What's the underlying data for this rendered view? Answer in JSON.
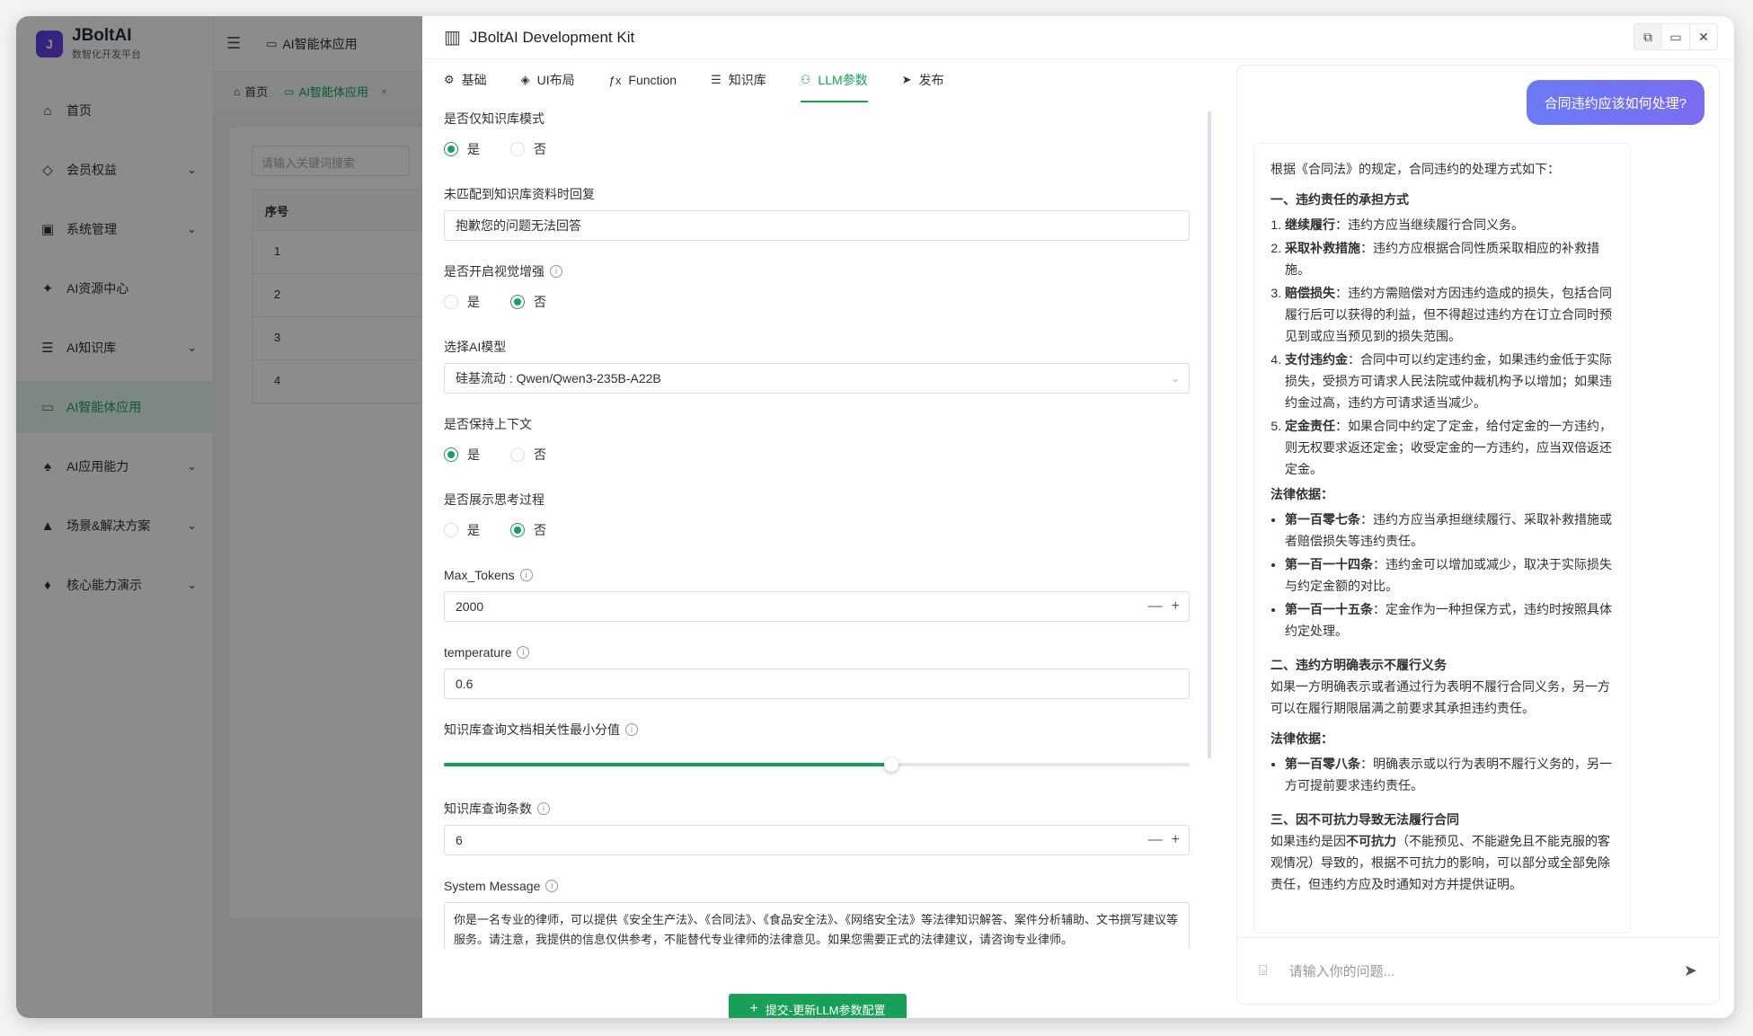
{
  "app": {
    "name": "JBoltAI",
    "subtitle": "数智化开发平台",
    "logo_mark": "J"
  },
  "sidebar": {
    "items": [
      {
        "label": "首页",
        "icon": "⌂",
        "arrow": ""
      },
      {
        "label": "会员权益",
        "icon": "◇",
        "arrow": "⌄"
      },
      {
        "label": "系统管理",
        "icon": "▣",
        "arrow": "⌄"
      },
      {
        "label": "AI资源中心",
        "icon": "✦",
        "arrow": ""
      },
      {
        "label": "AI知识库",
        "icon": "☰",
        "arrow": "⌄"
      },
      {
        "label": "AI智能体应用",
        "icon": "▭",
        "arrow": ""
      },
      {
        "label": "AI应用能力",
        "icon": "♠",
        "arrow": "⌄"
      },
      {
        "label": "场景&解决方案",
        "icon": "▲",
        "arrow": "⌄"
      },
      {
        "label": "核心能力演示",
        "icon": "♦",
        "arrow": "⌄"
      }
    ]
  },
  "topbar": {
    "collapse_icon": "☰",
    "crumb_icon": "▭",
    "crumb": "AI智能体应用"
  },
  "page_tabs": {
    "home_icon": "⌂",
    "home": "首页",
    "active_icon": "▭",
    "active": "AI智能体应用",
    "close": "×"
  },
  "bg_content": {
    "search_placeholder": "请输入关键词搜索",
    "column_header": "序号",
    "rows": [
      "1",
      "2",
      "3",
      "4"
    ]
  },
  "drawer": {
    "title_icon": "▥",
    "title": "JBoltAI Development Kit",
    "header_buttons": [
      "⧉",
      "▭",
      "✕"
    ],
    "tabs": [
      {
        "icon": "⚙",
        "label": "基础"
      },
      {
        "icon": "◈",
        "label": "UI布局"
      },
      {
        "icon": "ƒx",
        "label": "Function"
      },
      {
        "icon": "☰",
        "label": "知识库"
      },
      {
        "icon": "⚇",
        "label": "LLM参数"
      },
      {
        "icon": "➤",
        "label": "发布"
      }
    ],
    "radio_yes": "是",
    "radio_no": "否",
    "form": {
      "kb_only_label": "是否仅知识库模式",
      "no_match_reply_label": "未匹配到知识库资料时回复",
      "no_match_reply_value": "抱歉您的问题无法回答",
      "vision_label": "是否开启视觉增强",
      "model_label": "选择AI模型",
      "model_value": "硅基流动 : Qwen/Qwen3-235B-A22B",
      "keep_context_label": "是否保持上下文",
      "show_thinking_label": "是否展示思考过程",
      "max_tokens_label": "Max_Tokens",
      "max_tokens_value": "2000",
      "temperature_label": "temperature",
      "temperature_value": "0.6",
      "min_score_label": "知识库查询文档相关性最小分值",
      "min_score_fraction": 0.6,
      "query_count_label": "知识库查询条数",
      "query_count_value": "6",
      "system_message_label": "System Message",
      "system_message_value": "你是一名专业的律师，可以提供《安全生产法》、《合同法》、《食品安全法》、《网络安全法》等法律知识解答、案件分析辅助、文书撰写建议等服务。请注意，我提供的信息仅供参考，不能替代专业律师的法律意见。如果您需要正式的法律建议，请咨询专业律师。",
      "stepper_minus": "—",
      "stepper_plus": "+",
      "select_arrow": "⌄",
      "info_icon": "i"
    },
    "submit_icon": "+",
    "submit_label": "提交-更新LLM参数配置",
    "chat": {
      "user_question": "合同违约应该如何处理?",
      "intro": "根据《合同法》的规定，合同违约的处理方式如下：",
      "sec1_title": "一、违约责任的承担方式",
      "sec1_items": [
        {
          "b": "继续履行",
          "t": "：违约方应当继续履行合同义务。"
        },
        {
          "b": "采取补救措施",
          "t": "：违约方应根据合同性质采取相应的补救措施。"
        },
        {
          "b": "赔偿损失",
          "t": "：违约方需赔偿对方因违约造成的损失，包括合同履行后可以获得的利益，但不得超过违约方在订立合同时预见到或应当预见到的损失范围。"
        },
        {
          "b": "支付违约金",
          "t": "：合同中可以约定违约金，如果违约金低于实际损失，受损方可请求人民法院或仲裁机构予以增加；如果违约金过高，违约方可请求适当减少。"
        },
        {
          "b": "定金责任",
          "t": "：如果合同中约定了定金，给付定金的一方违约，则无权要求返还定金；收受定金的一方违约，应当双倍返还定金。"
        }
      ],
      "legal_basis_1": "法律依据：",
      "legal_items_1": [
        {
          "b": "第一百零七条",
          "t": "：违约方应当承担继续履行、采取补救措施或者赔偿损失等违约责任。"
        },
        {
          "b": "第一百一十四条",
          "t": "：违约金可以增加或减少，取决于实际损失与约定金额的对比。"
        },
        {
          "b": "第一百一十五条",
          "t": "：定金作为一种担保方式，违约时按照具体约定处理。"
        }
      ],
      "sec2_title": "二、违约方明确表示不履行义务",
      "sec2_text": "如果一方明确表示或者通过行为表明不履行合同义务，另一方可以在履行期限届满之前要求其承担违约责任。",
      "legal_basis_2": "法律依据：",
      "legal_items_2": [
        {
          "b": "第一百零八条",
          "t": "：明确表示或以行为表明不履行义务的，另一方可提前要求违约责任。"
        }
      ],
      "sec3_title": "三、因不可抗力导致无法履行合同",
      "sec3_text_pre": "如果违约是因",
      "sec3_text_b": "不可抗力",
      "sec3_text_post": "（不能预见、不能避免且不能克服的客观情况）导致的，根据不可抗力的影响，可以部分或全部免除责任，但违约方应及时通知对方并提供证明。",
      "input_placeholder": "请输入你的问题...",
      "attach_icon": "⌺",
      "send_icon": "➤"
    }
  }
}
